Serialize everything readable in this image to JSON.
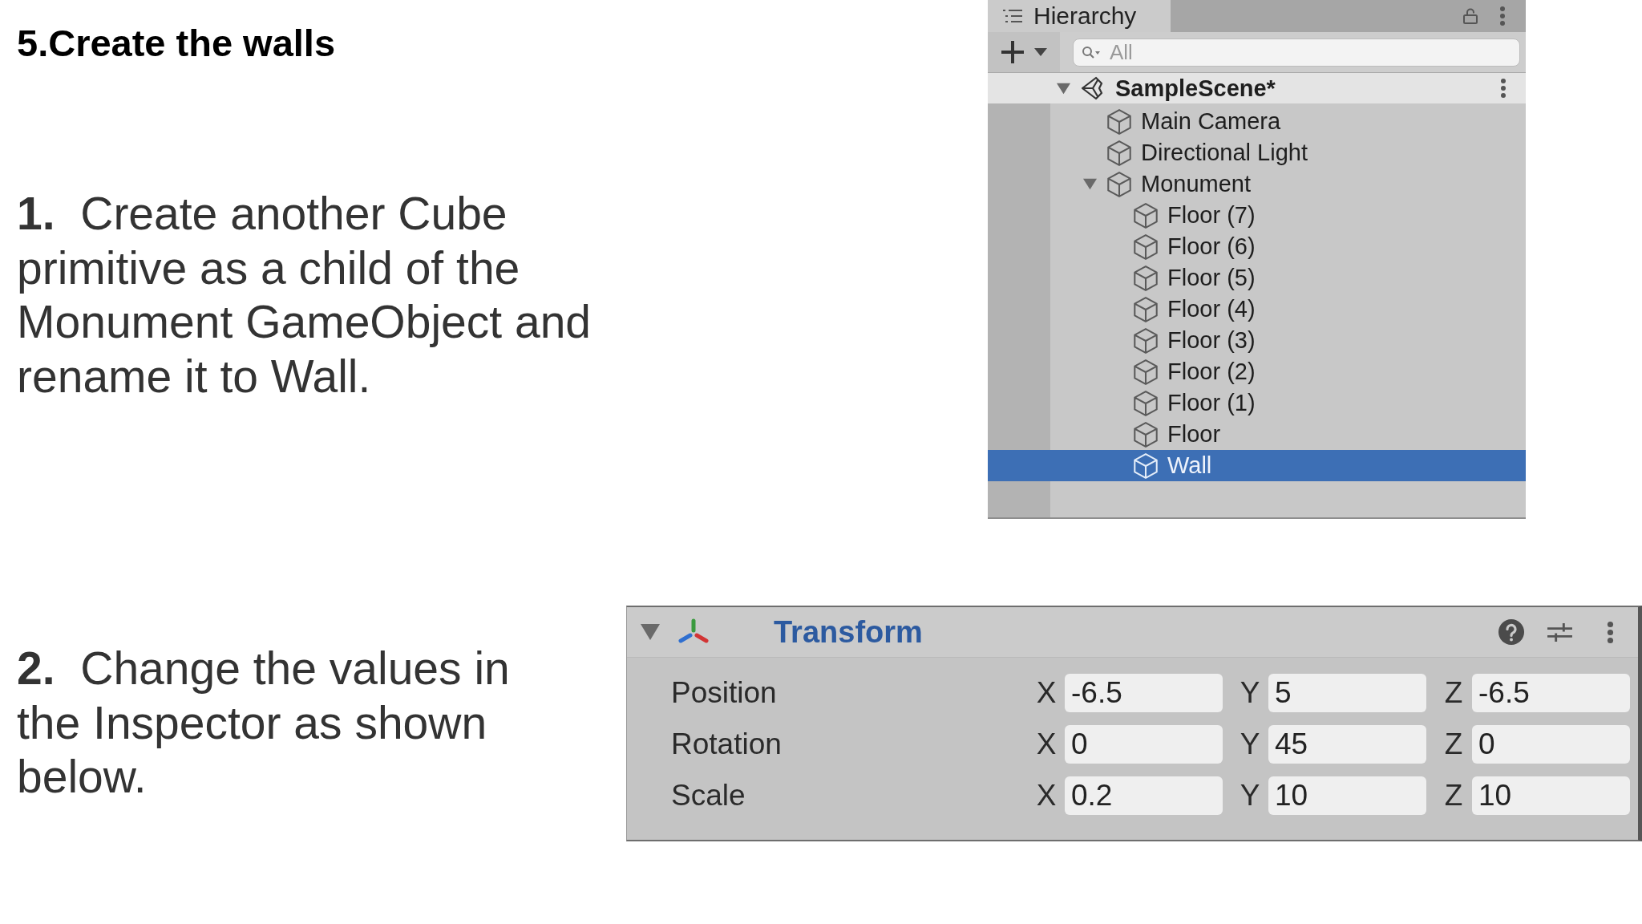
{
  "heading": "5.Create the walls",
  "steps": [
    {
      "text": "**1.**  Create another Cube primitive as a child of the Monument GameObject and rename it to Wall."
    },
    {
      "text": "**2.**  Change the values in the Inspector as shown below."
    }
  ],
  "hierarchy": {
    "tabs": [
      {
        "label": "Hierarchy",
        "selected": true
      }
    ],
    "search": {
      "placeholder": "All"
    },
    "scene": {
      "name": "SampleScene*",
      "expanded": true,
      "children": [
        {
          "name": "Main Camera",
          "selected": false
        },
        {
          "name": "Directional Light",
          "selected": false
        },
        {
          "name": "Monument",
          "selected": false,
          "expanded": true,
          "children": [
            {
              "name": "Floor (7)",
              "selected": false
            },
            {
              "name": "Floor (6)",
              "selected": false
            },
            {
              "name": "Floor (5)",
              "selected": false
            },
            {
              "name": "Floor (4)",
              "selected": false
            },
            {
              "name": "Floor (3)",
              "selected": false
            },
            {
              "name": "Floor (2)",
              "selected": false
            },
            {
              "name": "Floor (1)",
              "selected": false
            },
            {
              "name": "Floor",
              "selected": false
            },
            {
              "name": "Wall",
              "selected": true
            }
          ]
        }
      ]
    }
  },
  "inspector": {
    "component": {
      "title": "Transform",
      "expanded": true
    },
    "rows": [
      {
        "label": "Position",
        "fields": [
          {
            "axis": "X",
            "value": "-6.5"
          },
          {
            "axis": "Y",
            "value": "5"
          },
          {
            "axis": "Z",
            "value": "-6.5"
          }
        ]
      },
      {
        "label": "Rotation",
        "fields": [
          {
            "axis": "X",
            "value": "0"
          },
          {
            "axis": "Y",
            "value": "45"
          },
          {
            "axis": "Z",
            "value": "0"
          }
        ]
      },
      {
        "label": "Scale",
        "fields": [
          {
            "axis": "X",
            "value": "0.2"
          },
          {
            "axis": "Y",
            "value": "10"
          },
          {
            "axis": "Z",
            "value": "10"
          }
        ]
      }
    ]
  }
}
